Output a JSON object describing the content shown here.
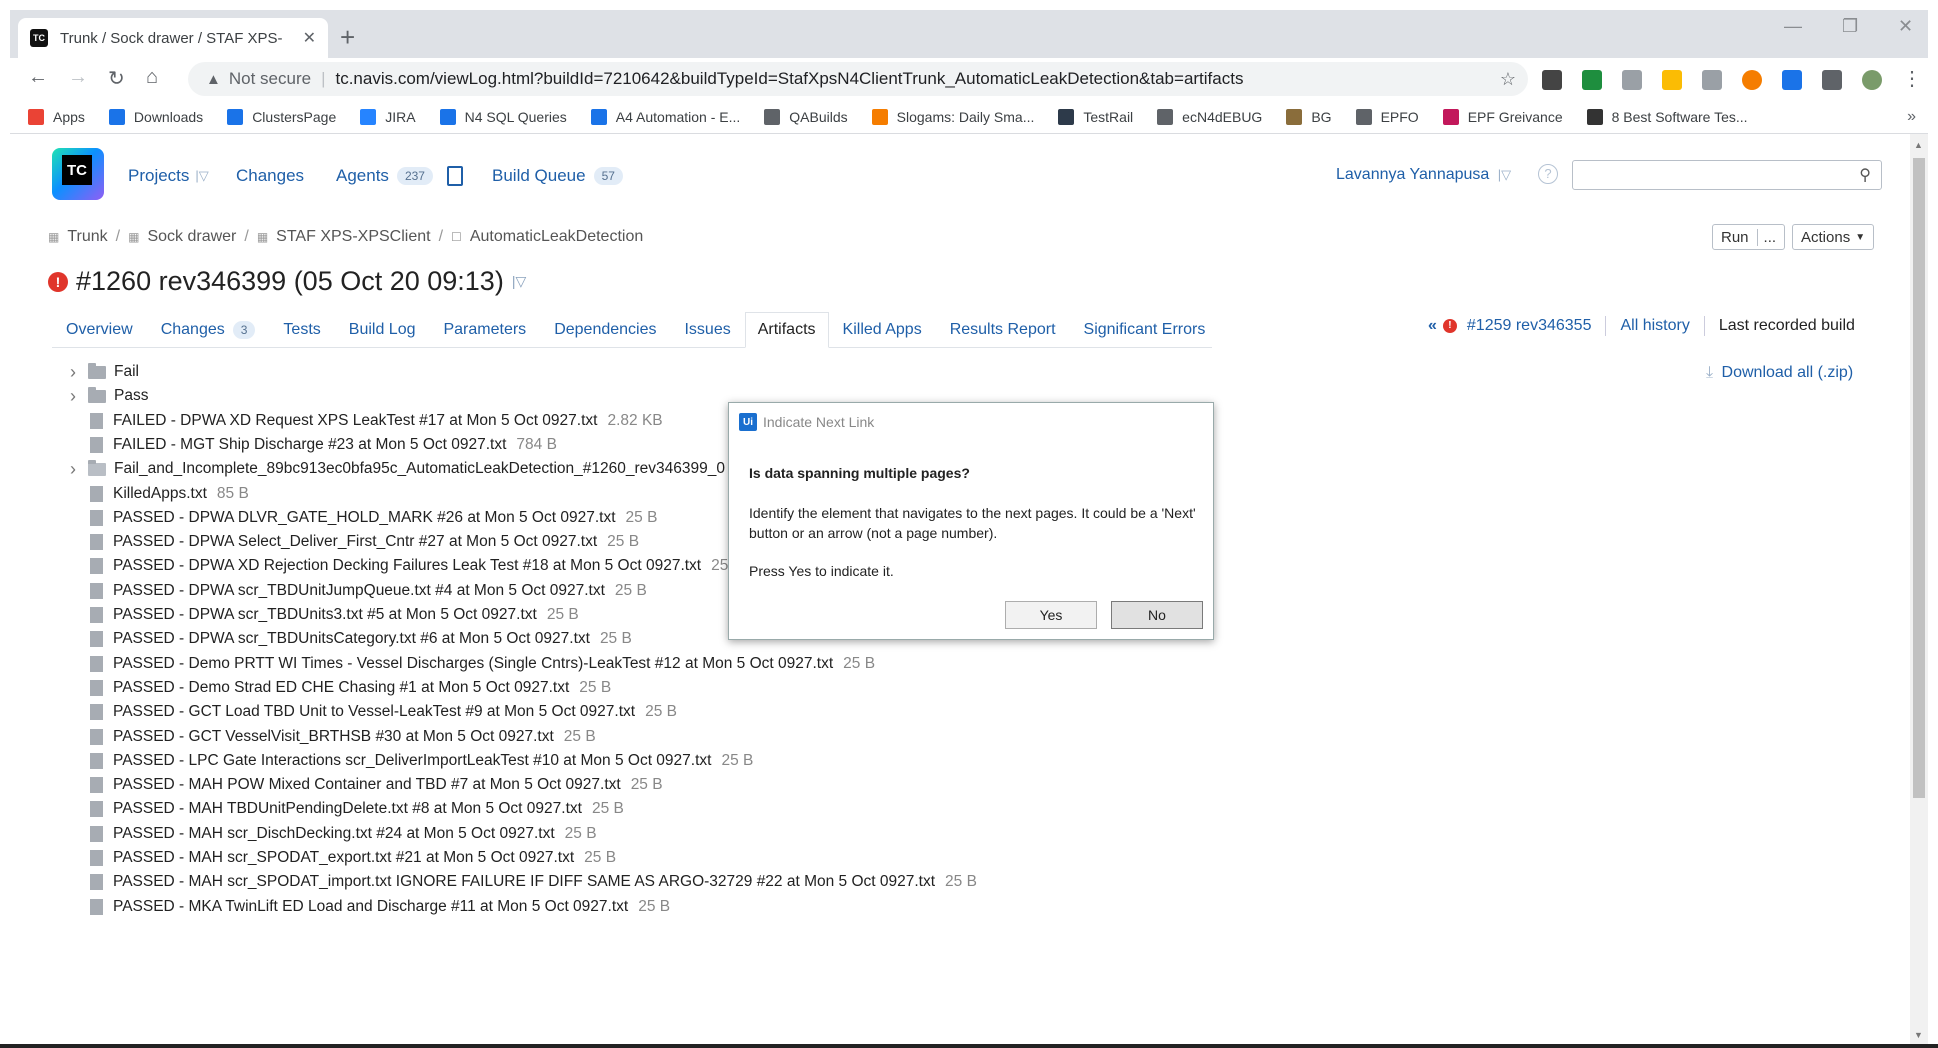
{
  "browser": {
    "tab_title": "Trunk / Sock drawer / STAF XPS-",
    "not_secure": "Not secure",
    "url": "tc.navis.com/viewLog.html?buildId=7210642&buildTypeId=StafXpsN4ClientTrunk_AutomaticLeakDetection&tab=artifacts",
    "bookmarks": [
      {
        "label": "Apps",
        "icon": "apps-grid-icon",
        "color": "#ea4335"
      },
      {
        "label": "Downloads",
        "icon": "download-icon",
        "color": "#1a73e8"
      },
      {
        "label": "ClustersPage",
        "icon": "jira-icon",
        "color": "#1a73e8"
      },
      {
        "label": "JIRA",
        "icon": "jira-diamond-icon",
        "color": "#2684ff"
      },
      {
        "label": "N4 SQL Queries",
        "icon": "jira-icon",
        "color": "#1a73e8"
      },
      {
        "label": "A4 Automation - E...",
        "icon": "jira-icon",
        "color": "#1a73e8"
      },
      {
        "label": "QABuilds",
        "icon": "globe-icon",
        "color": "#5f6368"
      },
      {
        "label": "Slogams: Daily Sma...",
        "icon": "blogger-icon",
        "color": "#f57d00"
      },
      {
        "label": "TestRail",
        "icon": "testrail-icon",
        "color": "#2d3a4a"
      },
      {
        "label": "ecN4dEBUG",
        "icon": "globe-icon",
        "color": "#5f6368"
      },
      {
        "label": "BG",
        "icon": "image-icon",
        "color": "#8a6d3b"
      },
      {
        "label": "EPFO",
        "icon": "globe-icon",
        "color": "#5f6368"
      },
      {
        "label": "EPF Greivance",
        "icon": "epf-icon",
        "color": "#c2185b"
      },
      {
        "label": "8 Best Software Tes...",
        "icon": "site-icon",
        "color": "#333333"
      }
    ]
  },
  "header": {
    "logo_text": "TC",
    "nav": [
      {
        "label": "Projects",
        "badge": "",
        "has_dropdown": true
      },
      {
        "label": "Changes",
        "badge": ""
      },
      {
        "label": "Agents",
        "badge": "237"
      },
      {
        "label": "Build Queue",
        "badge": "57"
      }
    ],
    "user": "Lavannya Yannapusa",
    "help": "?"
  },
  "breadcrumb": [
    "Trunk",
    "Sock drawer",
    "STAF XPS-XPSClient",
    "AutomaticLeakDetection"
  ],
  "actions": {
    "run": "Run",
    "more": "...",
    "actions": "Actions"
  },
  "build": {
    "title": "#1260 rev346399 (05 Oct 20 09:13)",
    "status_icon": "!"
  },
  "tabs": [
    {
      "label": "Overview",
      "badge": ""
    },
    {
      "label": "Changes",
      "badge": "3"
    },
    {
      "label": "Tests",
      "badge": ""
    },
    {
      "label": "Build Log",
      "badge": ""
    },
    {
      "label": "Parameters",
      "badge": ""
    },
    {
      "label": "Dependencies",
      "badge": ""
    },
    {
      "label": "Issues",
      "badge": ""
    },
    {
      "label": "Artifacts",
      "badge": "",
      "active": true
    },
    {
      "label": "Killed Apps",
      "badge": ""
    },
    {
      "label": "Results Report",
      "badge": ""
    },
    {
      "label": "Significant Errors",
      "badge": ""
    }
  ],
  "history": {
    "prev_build": "#1259 rev346355",
    "all_history": "All history",
    "last_recorded": "Last recorded build"
  },
  "download_all": "Download all (.zip)",
  "artifacts": [
    {
      "type": "folder",
      "name": "Fail",
      "size": ""
    },
    {
      "type": "folder",
      "name": "Pass",
      "size": ""
    },
    {
      "type": "file",
      "name": "FAILED - DPWA XD Request XPS LeakTest #17 at Mon 5 Oct 0927.txt",
      "size": "2.82 KB"
    },
    {
      "type": "file",
      "name": "FAILED - MGT Ship Discharge #23 at Mon 5 Oct 0927.txt",
      "size": "784 B"
    },
    {
      "type": "archive",
      "name": "Fail_and_Incomplete_89bc913ec0bfa95c_AutomaticLeakDetection_#1260_rev346399_0",
      "size": ""
    },
    {
      "type": "file",
      "name": "KilledApps.txt",
      "size": "85 B"
    },
    {
      "type": "file",
      "name": "PASSED - DPWA DLVR_GATE_HOLD_MARK #26 at Mon 5 Oct 0927.txt",
      "size": "25 B"
    },
    {
      "type": "file",
      "name": "PASSED - DPWA Select_Deliver_First_Cntr #27 at Mon 5 Oct 0927.txt",
      "size": "25 B"
    },
    {
      "type": "file",
      "name": "PASSED - DPWA XD Rejection Decking Failures Leak Test #18 at Mon 5 Oct 0927.txt",
      "size": "25 B"
    },
    {
      "type": "file",
      "name": "PASSED - DPWA scr_TBDUnitJumpQueue.txt #4 at Mon 5 Oct 0927.txt",
      "size": "25 B"
    },
    {
      "type": "file",
      "name": "PASSED - DPWA scr_TBDUnits3.txt #5 at Mon 5 Oct 0927.txt",
      "size": "25 B"
    },
    {
      "type": "file",
      "name": "PASSED - DPWA scr_TBDUnitsCategory.txt #6 at Mon 5 Oct 0927.txt",
      "size": "25 B"
    },
    {
      "type": "file",
      "name": "PASSED - Demo PRTT WI Times - Vessel Discharges (Single Cntrs)-LeakTest #12 at Mon 5 Oct 0927.txt",
      "size": "25 B"
    },
    {
      "type": "file",
      "name": "PASSED - Demo Strad ED CHE Chasing #1 at Mon 5 Oct 0927.txt",
      "size": "25 B"
    },
    {
      "type": "file",
      "name": "PASSED - GCT Load TBD Unit to Vessel-LeakTest #9 at Mon 5 Oct 0927.txt",
      "size": "25 B"
    },
    {
      "type": "file",
      "name": "PASSED - GCT VesselVisit_BRTHSB #30 at Mon 5 Oct 0927.txt",
      "size": "25 B"
    },
    {
      "type": "file",
      "name": "PASSED - LPC Gate Interactions scr_DeliverImportLeakTest #10 at Mon 5 Oct 0927.txt",
      "size": "25 B"
    },
    {
      "type": "file",
      "name": "PASSED - MAH POW Mixed Container and TBD #7 at Mon 5 Oct 0927.txt",
      "size": "25 B"
    },
    {
      "type": "file",
      "name": "PASSED - MAH TBDUnitPendingDelete.txt #8 at Mon 5 Oct 0927.txt",
      "size": "25 B"
    },
    {
      "type": "file",
      "name": "PASSED - MAH scr_DischDecking.txt #24 at Mon 5 Oct 0927.txt",
      "size": "25 B"
    },
    {
      "type": "file",
      "name": "PASSED - MAH scr_SPODAT_export.txt #21 at Mon 5 Oct 0927.txt",
      "size": "25 B"
    },
    {
      "type": "file",
      "name": "PASSED - MAH scr_SPODAT_import.txt IGNORE FAILURE IF DIFF SAME AS ARGO-32729 #22 at Mon 5 Oct 0927.txt",
      "size": "25 B"
    },
    {
      "type": "file",
      "name": "PASSED - MKA TwinLift ED Load and Discharge #11 at Mon 5 Oct 0927.txt",
      "size": "25 B"
    }
  ],
  "dialog": {
    "title": "Indicate Next Link",
    "icon_text": "Ui",
    "question": "Is data spanning multiple pages?",
    "body": "Identify the element that navigates to the next pages. It could be a 'Next' button or an arrow (not a page number).",
    "body2": "Press Yes to indicate it.",
    "yes": "Yes",
    "no": "No"
  }
}
